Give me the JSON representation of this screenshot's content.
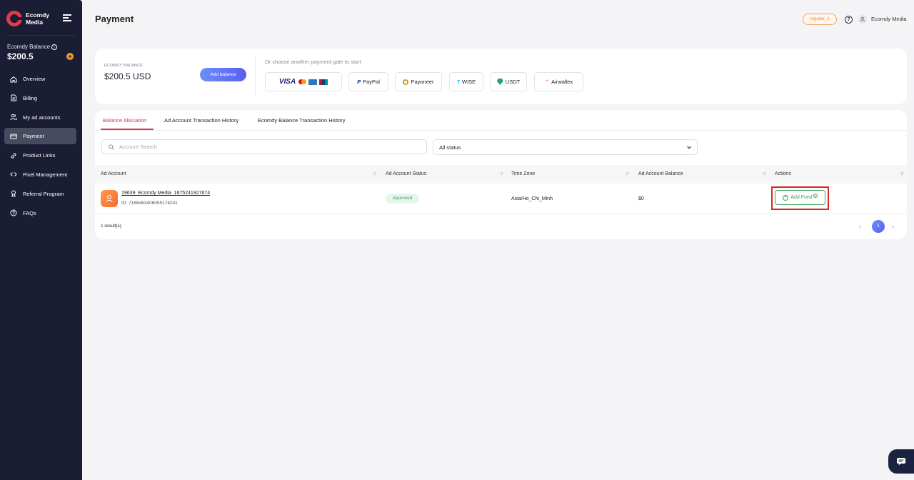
{
  "brand": {
    "name": "Ecomdy Media"
  },
  "sidebar": {
    "balance_label": "Ecomdy Balance",
    "balance_value": "$200.5",
    "items": [
      {
        "label": "Overview",
        "icon": "home-icon"
      },
      {
        "label": "Billing",
        "icon": "document-icon"
      },
      {
        "label": "My ad accounts",
        "icon": "users-icon"
      },
      {
        "label": "Payment",
        "icon": "card-icon",
        "active": true
      },
      {
        "label": "Product Links",
        "icon": "link-icon"
      },
      {
        "label": "Pixel Management",
        "icon": "code-icon"
      },
      {
        "label": "Referral Program",
        "icon": "medal-icon"
      },
      {
        "label": "FAQs",
        "icon": "help-icon"
      }
    ]
  },
  "header": {
    "title": "Payment",
    "tier_badge": "regular_1",
    "user_name": "Ecomdy Media"
  },
  "balance_card": {
    "label": "ECOMDY BALANCE",
    "value": "$200.5 USD",
    "add_button": "Add balance",
    "gate_hint": "Or choose another payment gate to start",
    "gates": [
      {
        "label": "VISA",
        "icon": "cards-icon"
      },
      {
        "label": "PayPal",
        "icon": "paypal-icon"
      },
      {
        "label": "Payoneer",
        "icon": "payoneer-icon"
      },
      {
        "label": "WISE",
        "icon": "wise-icon"
      },
      {
        "label": "USDT",
        "icon": "usdt-icon"
      },
      {
        "label": "Airwallex",
        "icon": "airwallex-icon"
      }
    ]
  },
  "tabs": [
    "Balance Allocation",
    "Ad Account Transaction History",
    "Ecomdy Balance Transaction History"
  ],
  "filters": {
    "search_placeholder": "Account Search",
    "status_value": "All status"
  },
  "table": {
    "headers": [
      "Ad Account",
      "Ad Account Status",
      "Time Zone",
      "Ad Account Balance",
      "Actions"
    ],
    "rows": [
      {
        "name": "19639_Ecomdy Media_1675241927674",
        "id": "ID: 7166463406055178241",
        "status": "Approved",
        "timezone": "Asia/Ho_Chi_Minh",
        "balance": "$0",
        "action": "Add Fund"
      }
    ]
  },
  "pagination": {
    "results": "1 result(s)",
    "current": "1"
  },
  "colors": {
    "sidebar": "#1a1d33",
    "accent": "#d93448",
    "primary": "#5b5ef0",
    "success": "#3aa35a"
  }
}
